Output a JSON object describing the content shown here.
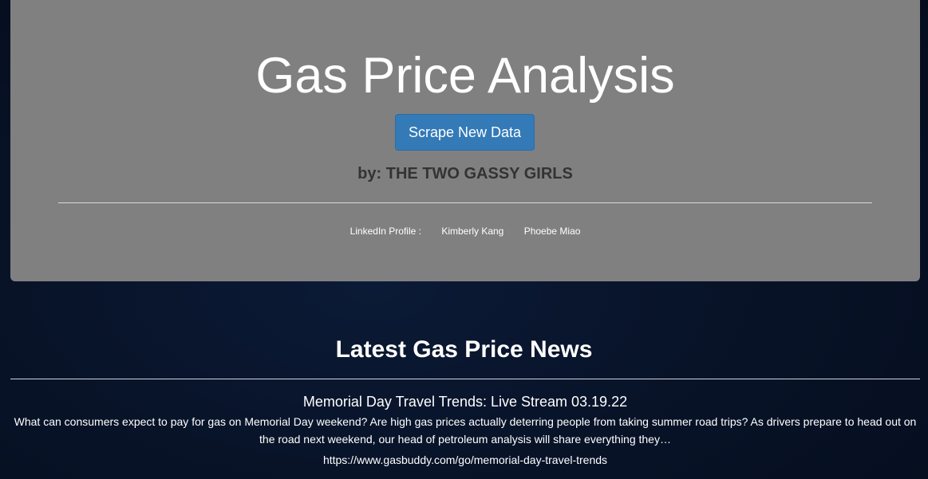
{
  "header": {
    "title": "Gas Price Analysis",
    "scrape_button_label": "Scrape New Data",
    "byline": "by: THE TWO GASSY GIRLS",
    "linkedin_label": "LinkedIn Profile :",
    "profiles": [
      "Kimberly Kang",
      "Phoebe Miao"
    ]
  },
  "news": {
    "section_title": "Latest Gas Price News",
    "articles": [
      {
        "headline": "Memorial Day Travel Trends: Live Stream 03.19.22",
        "summary": "What can consumers expect to pay for gas on Memorial Day weekend? Are high gas prices actually deterring people from taking summer road trips? As drivers prepare to head out on the road next weekend, our head of petroleum analysis will share everything they…",
        "url": "https://www.gasbuddy.com/go/memorial-day-travel-trends"
      }
    ]
  },
  "colors": {
    "page_background": "#081226",
    "jumbotron_background": "#808080",
    "button_primary": "#337ab7",
    "byline_text": "#333333",
    "text": "#ffffff"
  }
}
